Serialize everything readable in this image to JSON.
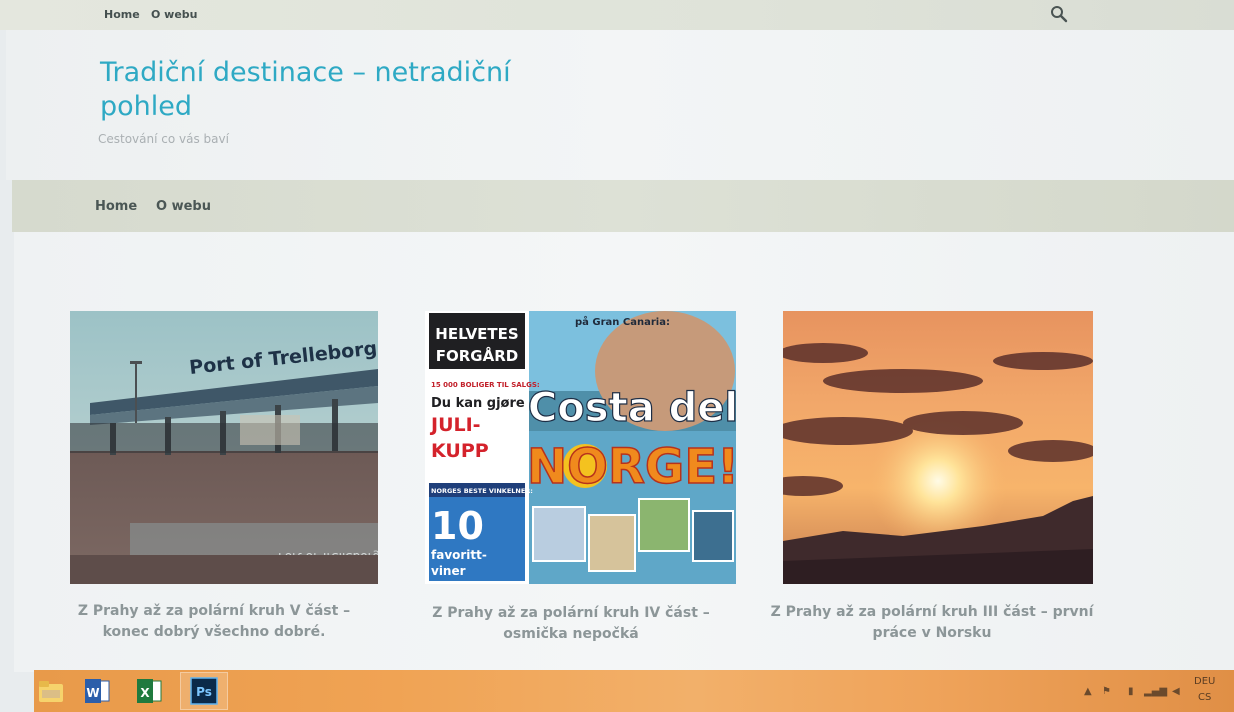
{
  "topbar": {
    "nav": [
      "Home",
      "O webu"
    ]
  },
  "header": {
    "title": "Tradiční destinace – netradiční pohled",
    "tagline": "Cestování co vás baví"
  },
  "main_nav": [
    "Home",
    "O webu"
  ],
  "posts": [
    {
      "title": "Z Prahy až za polární kruh V část – konec dobrý všechno dobré.",
      "image_text": "Port of Trelleborg",
      "image_reflection": "Port of Trelleborg"
    },
    {
      "title": "Z Prahy až za polární kruh IV část – osmička nepočká",
      "image_text": {
        "headline1": "HELVETES",
        "headline2": "FORGÅRD",
        "top": "på Gran Canaria:",
        "line1": "15 000 BOLIGER TIL SALGS:",
        "line2": "Du kan gjøre",
        "line3": "JULI-",
        "line4": "KUPP",
        "line5": "NORGES BESTE VINKELNER:",
        "big1": "Costa del",
        "big2": "NORGE!",
        "num": "10",
        "line6": "favoritt-",
        "line7": "viner"
      }
    },
    {
      "title": "Z Prahy až za polární kruh III část – první práce v Norsku"
    }
  ],
  "taskbar": {
    "apps": [
      "file-explorer",
      "word",
      "excel",
      "photoshop"
    ],
    "ps_label": "Ps",
    "word_label": "W",
    "excel_label": "X",
    "lang_top": "DEU",
    "lang_bottom": "CS"
  },
  "colors": {
    "title": "#2ea9c4",
    "taskbar": "#f0a354"
  }
}
